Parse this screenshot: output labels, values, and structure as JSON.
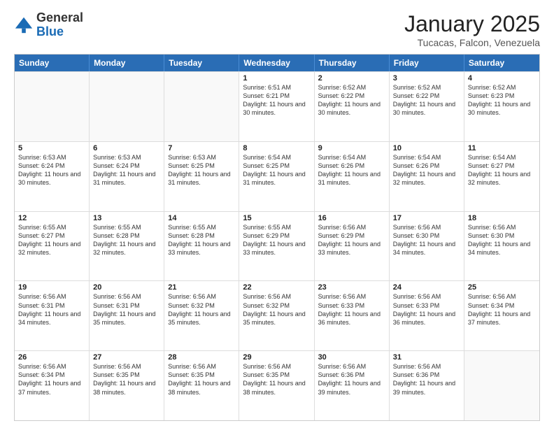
{
  "logo": {
    "general": "General",
    "blue": "Blue"
  },
  "title": "January 2025",
  "location": "Tucacas, Falcon, Venezuela",
  "header": {
    "days": [
      "Sunday",
      "Monday",
      "Tuesday",
      "Wednesday",
      "Thursday",
      "Friday",
      "Saturday"
    ]
  },
  "rows": [
    [
      {
        "day": "",
        "info": "",
        "empty": true
      },
      {
        "day": "",
        "info": "",
        "empty": true
      },
      {
        "day": "",
        "info": "",
        "empty": true
      },
      {
        "day": "1",
        "info": "Sunrise: 6:51 AM\nSunset: 6:21 PM\nDaylight: 11 hours and 30 minutes."
      },
      {
        "day": "2",
        "info": "Sunrise: 6:52 AM\nSunset: 6:22 PM\nDaylight: 11 hours and 30 minutes."
      },
      {
        "day": "3",
        "info": "Sunrise: 6:52 AM\nSunset: 6:22 PM\nDaylight: 11 hours and 30 minutes."
      },
      {
        "day": "4",
        "info": "Sunrise: 6:52 AM\nSunset: 6:23 PM\nDaylight: 11 hours and 30 minutes."
      }
    ],
    [
      {
        "day": "5",
        "info": "Sunrise: 6:53 AM\nSunset: 6:24 PM\nDaylight: 11 hours and 30 minutes."
      },
      {
        "day": "6",
        "info": "Sunrise: 6:53 AM\nSunset: 6:24 PM\nDaylight: 11 hours and 31 minutes."
      },
      {
        "day": "7",
        "info": "Sunrise: 6:53 AM\nSunset: 6:25 PM\nDaylight: 11 hours and 31 minutes."
      },
      {
        "day": "8",
        "info": "Sunrise: 6:54 AM\nSunset: 6:25 PM\nDaylight: 11 hours and 31 minutes."
      },
      {
        "day": "9",
        "info": "Sunrise: 6:54 AM\nSunset: 6:26 PM\nDaylight: 11 hours and 31 minutes."
      },
      {
        "day": "10",
        "info": "Sunrise: 6:54 AM\nSunset: 6:26 PM\nDaylight: 11 hours and 32 minutes."
      },
      {
        "day": "11",
        "info": "Sunrise: 6:54 AM\nSunset: 6:27 PM\nDaylight: 11 hours and 32 minutes."
      }
    ],
    [
      {
        "day": "12",
        "info": "Sunrise: 6:55 AM\nSunset: 6:27 PM\nDaylight: 11 hours and 32 minutes."
      },
      {
        "day": "13",
        "info": "Sunrise: 6:55 AM\nSunset: 6:28 PM\nDaylight: 11 hours and 32 minutes."
      },
      {
        "day": "14",
        "info": "Sunrise: 6:55 AM\nSunset: 6:28 PM\nDaylight: 11 hours and 33 minutes."
      },
      {
        "day": "15",
        "info": "Sunrise: 6:55 AM\nSunset: 6:29 PM\nDaylight: 11 hours and 33 minutes."
      },
      {
        "day": "16",
        "info": "Sunrise: 6:56 AM\nSunset: 6:29 PM\nDaylight: 11 hours and 33 minutes."
      },
      {
        "day": "17",
        "info": "Sunrise: 6:56 AM\nSunset: 6:30 PM\nDaylight: 11 hours and 34 minutes."
      },
      {
        "day": "18",
        "info": "Sunrise: 6:56 AM\nSunset: 6:30 PM\nDaylight: 11 hours and 34 minutes."
      }
    ],
    [
      {
        "day": "19",
        "info": "Sunrise: 6:56 AM\nSunset: 6:31 PM\nDaylight: 11 hours and 34 minutes."
      },
      {
        "day": "20",
        "info": "Sunrise: 6:56 AM\nSunset: 6:31 PM\nDaylight: 11 hours and 35 minutes."
      },
      {
        "day": "21",
        "info": "Sunrise: 6:56 AM\nSunset: 6:32 PM\nDaylight: 11 hours and 35 minutes."
      },
      {
        "day": "22",
        "info": "Sunrise: 6:56 AM\nSunset: 6:32 PM\nDaylight: 11 hours and 35 minutes."
      },
      {
        "day": "23",
        "info": "Sunrise: 6:56 AM\nSunset: 6:33 PM\nDaylight: 11 hours and 36 minutes."
      },
      {
        "day": "24",
        "info": "Sunrise: 6:56 AM\nSunset: 6:33 PM\nDaylight: 11 hours and 36 minutes."
      },
      {
        "day": "25",
        "info": "Sunrise: 6:56 AM\nSunset: 6:34 PM\nDaylight: 11 hours and 37 minutes."
      }
    ],
    [
      {
        "day": "26",
        "info": "Sunrise: 6:56 AM\nSunset: 6:34 PM\nDaylight: 11 hours and 37 minutes."
      },
      {
        "day": "27",
        "info": "Sunrise: 6:56 AM\nSunset: 6:35 PM\nDaylight: 11 hours and 38 minutes."
      },
      {
        "day": "28",
        "info": "Sunrise: 6:56 AM\nSunset: 6:35 PM\nDaylight: 11 hours and 38 minutes."
      },
      {
        "day": "29",
        "info": "Sunrise: 6:56 AM\nSunset: 6:35 PM\nDaylight: 11 hours and 38 minutes."
      },
      {
        "day": "30",
        "info": "Sunrise: 6:56 AM\nSunset: 6:36 PM\nDaylight: 11 hours and 39 minutes."
      },
      {
        "day": "31",
        "info": "Sunrise: 6:56 AM\nSunset: 6:36 PM\nDaylight: 11 hours and 39 minutes."
      },
      {
        "day": "",
        "info": "",
        "empty": true
      }
    ]
  ]
}
